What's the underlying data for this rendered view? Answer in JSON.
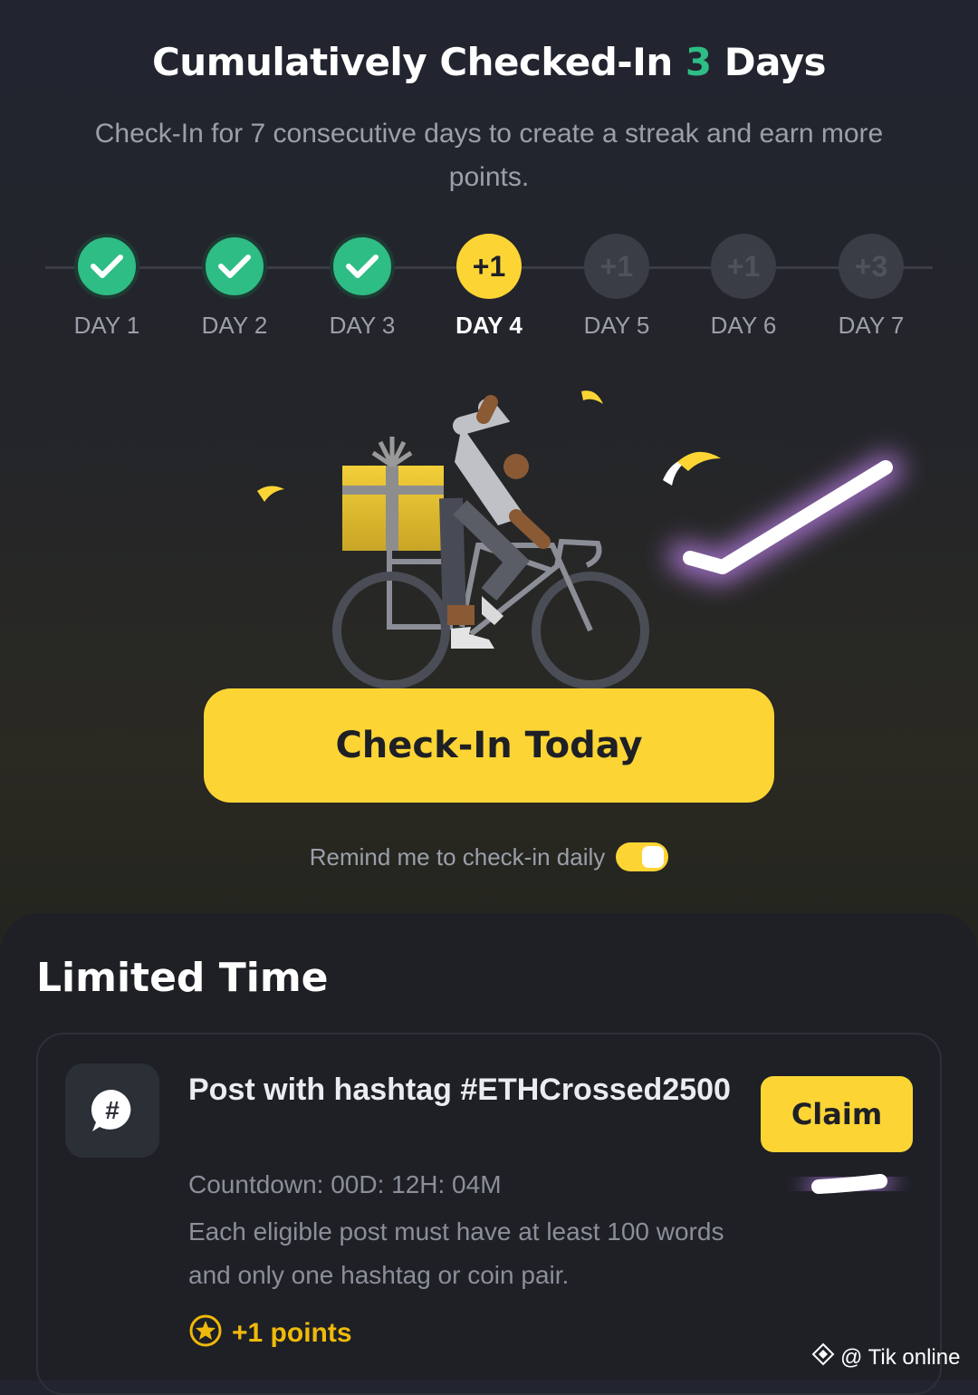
{
  "header": {
    "title_prefix": "Cumulatively Checked-In ",
    "title_count": "3",
    "title_suffix": " Days",
    "subtitle": "Check-In for 7 consecutive days to create a streak and earn more points."
  },
  "streak": {
    "days": [
      {
        "label": "DAY 1",
        "status": "done",
        "reward": ""
      },
      {
        "label": "DAY 2",
        "status": "done",
        "reward": ""
      },
      {
        "label": "DAY 3",
        "status": "done",
        "reward": ""
      },
      {
        "label": "DAY 4",
        "status": "today",
        "reward": "+1"
      },
      {
        "label": "DAY 5",
        "status": "future",
        "reward": "+1"
      },
      {
        "label": "DAY 6",
        "status": "future",
        "reward": "+1"
      },
      {
        "label": "DAY 7",
        "status": "future",
        "reward": "+3"
      }
    ]
  },
  "checkin_button": "Check-In Today",
  "reminder": {
    "label": "Remind me to check-in daily",
    "enabled": true
  },
  "limited": {
    "title": "Limited Time",
    "task": {
      "icon": "hashtag-chat-icon",
      "title": "Post with hashtag #ETHCrossed2500",
      "countdown": "Countdown: 00D: 12H: 04M",
      "description": "Each eligible post must have at least 100 words and only one hashtag or coin pair.",
      "points": "+1 points",
      "claim": "Claim"
    }
  },
  "watermark": "@ Tik online",
  "colors": {
    "accent": "#fcd535",
    "success": "#2ebd85",
    "bg": "#1e2026"
  }
}
